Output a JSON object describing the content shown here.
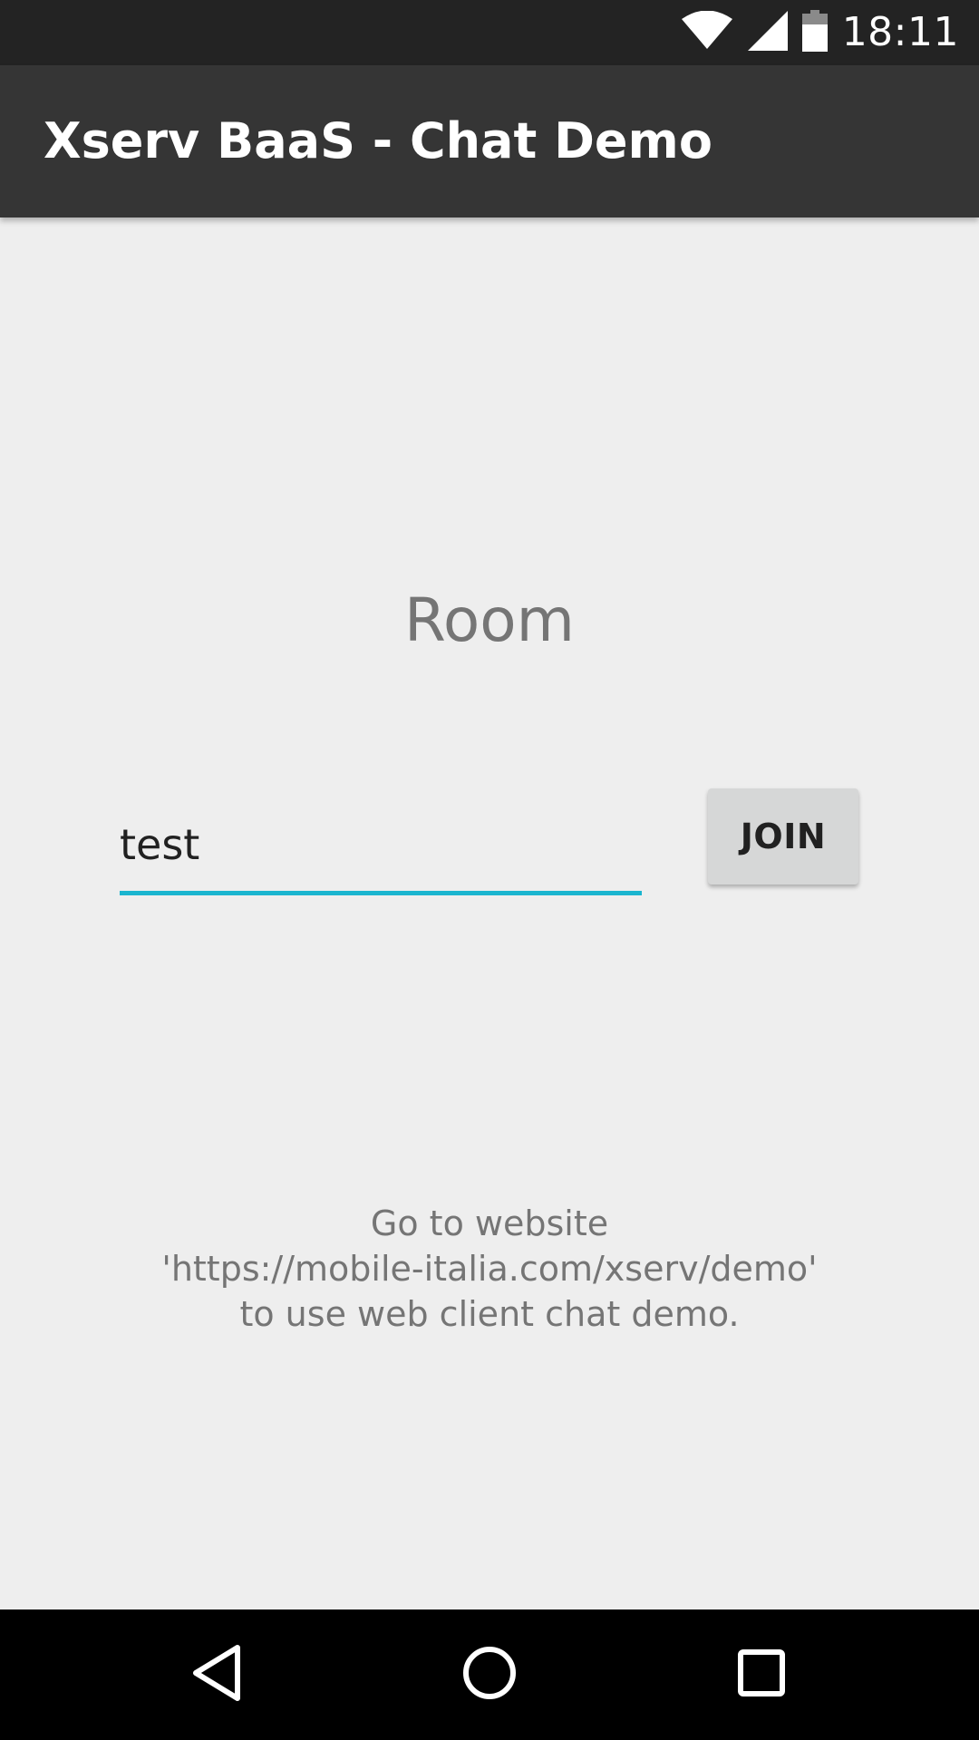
{
  "status_bar": {
    "time": "18:11",
    "icons": [
      "wifi-icon",
      "cell-signal-icon",
      "battery-icon"
    ]
  },
  "app_bar": {
    "title": "Xserv BaaS - Chat Demo"
  },
  "room": {
    "label": "Room",
    "input_value": "test",
    "join_label": "JOIN"
  },
  "info": {
    "line1": "Go to website",
    "line2": "'https://mobile-italia.com/xserv/demo'",
    "line3": "to use web client chat demo."
  },
  "nav_bar": {
    "icons": [
      "back-icon",
      "home-icon",
      "recents-icon"
    ]
  },
  "colors": {
    "status_bar": "#232323",
    "app_bar": "#353535",
    "background": "#eeeeee",
    "accent": "#1ab5cf",
    "button": "#d6d7d7",
    "secondary_text": "#757575"
  }
}
